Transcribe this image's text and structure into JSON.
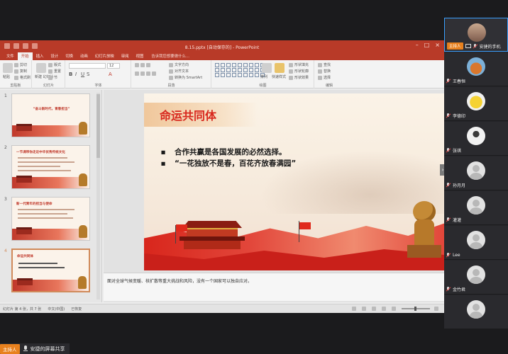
{
  "ppt": {
    "title": "8.15.pptx [自动保存的] - PowerPoint",
    "tabs": [
      "文件",
      "开始",
      "插入",
      "设计",
      "切换",
      "动画",
      "幻灯片放映",
      "审阅",
      "视图"
    ],
    "active_tab": "开始",
    "tell_me": "告诉我您想要做什么...",
    "ribbon": {
      "paste": "粘贴",
      "clipboard_items": [
        "剪切",
        "复制",
        "格式刷"
      ],
      "new_slide": "新建\n幻灯片",
      "slide_items": [
        "版式",
        "重置",
        "节"
      ],
      "font_size": "12",
      "bold": "B",
      "italic": "I",
      "underline": "U",
      "shadow": "S",
      "para_items": [
        "文字方向",
        "对齐文本",
        "转换为 SmartArt"
      ],
      "arrange": "排列",
      "quick_styles": "快速样式",
      "shape_items": [
        "形状填充",
        "形状轮廓",
        "形状效果"
      ],
      "edit_items": [
        "查找",
        "替换",
        "选择"
      ],
      "group_labels": {
        "clipboard": "剪贴板",
        "slides": "幻灯片",
        "font": "字体",
        "paragraph": "段落",
        "drawing": "绘图",
        "editing": "编辑"
      }
    },
    "thumbnails": [
      {
        "num": "1",
        "title": "“奋斗新时代，青春担当”"
      },
      {
        "num": "2",
        "title": "一节课带你走近中华优秀传统文化"
      },
      {
        "num": "3",
        "title": "新一代青年的担当与使命"
      },
      {
        "num": "4",
        "title": "命运共同体"
      }
    ],
    "selected_thumb": 4,
    "slide": {
      "title": "命运共同体",
      "bullets": [
        "合作共赢是各国发展的必然选择。",
        "“一花独放不是春，百花齐放春满园”"
      ],
      "bullet_char": "▪",
      "next_arrow": "›"
    },
    "notes": "面对全球气候变暖、核扩散等重大挑战和风险，没有一个国家可以独自应对。",
    "status": {
      "slide_of": "幻灯片 第 4 张，共 7 张",
      "language": "中文(中国)",
      "restore": "已恢复"
    }
  },
  "participants": [
    {
      "name": "安捷的手机",
      "host": true,
      "host_label": "主持人",
      "avatar": "photo-female"
    },
    {
      "name": "王春恒",
      "host": false,
      "avatar": "photo-cartoon"
    },
    {
      "name": "李德印",
      "host": false,
      "avatar": "photo-yellow"
    },
    {
      "name": "张琪",
      "host": false,
      "avatar": "photo-sketch"
    },
    {
      "name": "孙月月",
      "host": false,
      "avatar": "default"
    },
    {
      "name": "灌灌",
      "host": false,
      "avatar": "default"
    },
    {
      "name": "Lee",
      "host": false,
      "avatar": "default"
    },
    {
      "name": "金竹君",
      "host": false,
      "avatar": "default"
    },
    {
      "name": "",
      "host": false,
      "avatar": "default"
    }
  ],
  "sharebar": {
    "host_label": "主持人",
    "text": "安捷的屏幕共享"
  },
  "colors": {
    "ppt_accent": "#b83a28",
    "slide_title": "#d8281e",
    "host_badge": "#e8811e"
  }
}
